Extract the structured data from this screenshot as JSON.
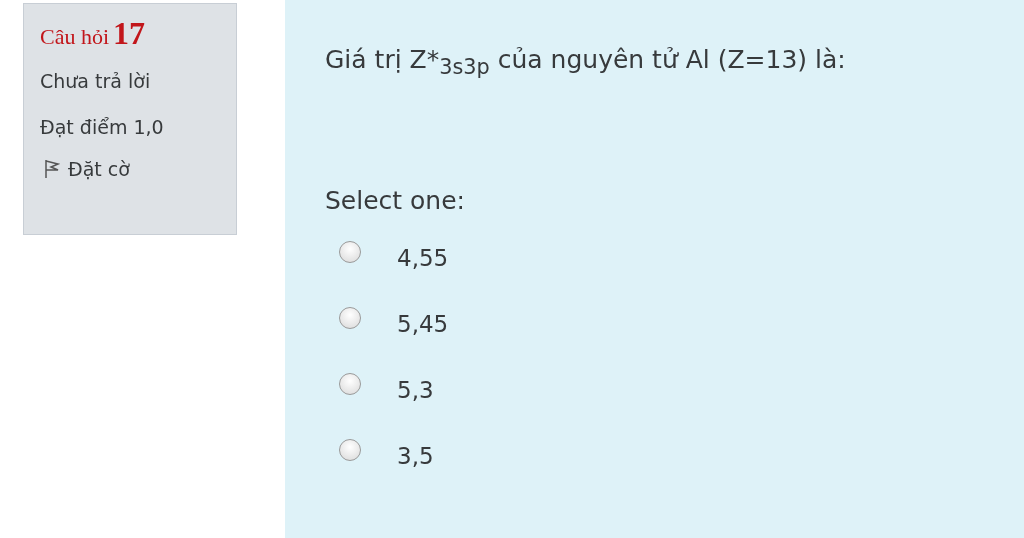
{
  "info": {
    "question_label": "Câu hỏi",
    "question_number": "17",
    "status": "Chưa trả lời",
    "mark": "Đạt điểm 1,0",
    "flag": {
      "label": "Đặt cờ",
      "flagged": false
    }
  },
  "question": {
    "text": "Giá trị Z*$_{3s3p}$ của nguyên tử Al (Z=13) là:",
    "prompt": "Select one:",
    "options": [
      {
        "label": "4,55",
        "selected": false
      },
      {
        "label": "5,45",
        "selected": false
      },
      {
        "label": "5,3",
        "selected": false
      },
      {
        "label": "3,5",
        "selected": false
      }
    ]
  }
}
